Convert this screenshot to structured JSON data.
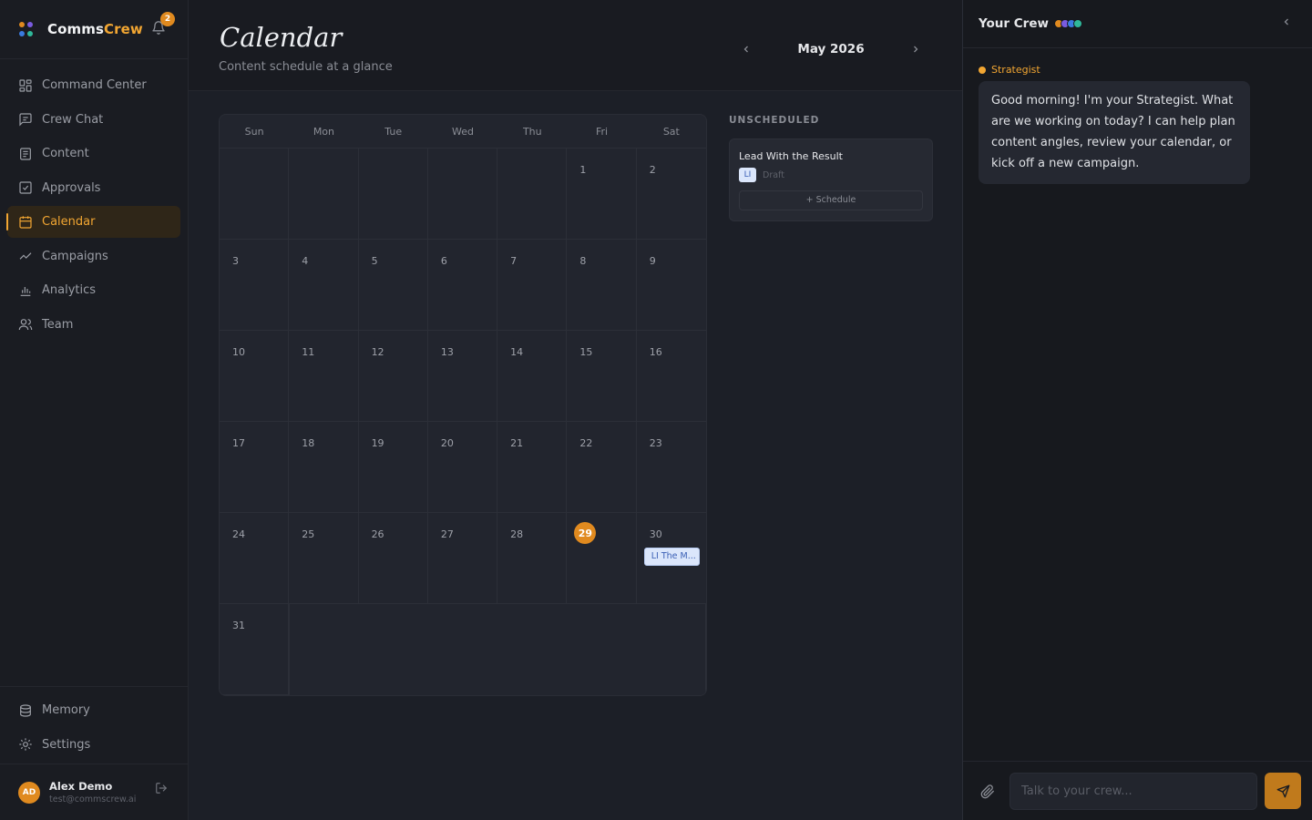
{
  "brand": {
    "name_main": "Comms",
    "name_accent": "Crew",
    "notification_count": "2"
  },
  "sidebar": {
    "items": [
      {
        "label": "Command Center",
        "icon": "dashboard-icon"
      },
      {
        "label": "Crew Chat",
        "icon": "chat-icon"
      },
      {
        "label": "Content",
        "icon": "document-icon"
      },
      {
        "label": "Approvals",
        "icon": "checkbox-icon"
      },
      {
        "label": "Calendar",
        "icon": "calendar-icon",
        "active": true
      },
      {
        "label": "Campaigns",
        "icon": "trend-icon"
      },
      {
        "label": "Analytics",
        "icon": "bar-chart-icon"
      },
      {
        "label": "Team",
        "icon": "users-icon"
      }
    ],
    "bottom_items": [
      {
        "label": "Memory",
        "icon": "database-icon"
      },
      {
        "label": "Settings",
        "icon": "gear-icon"
      }
    ],
    "user": {
      "initials": "AD",
      "name": "Alex Demo",
      "email": "test@commscrew.ai"
    }
  },
  "header": {
    "title": "Calendar",
    "subtitle": "Content schedule at a glance",
    "month": "May 2026"
  },
  "calendar": {
    "weekdays": [
      "Sun",
      "Mon",
      "Tue",
      "Wed",
      "Thu",
      "Fri",
      "Sat"
    ],
    "leading_blanks": 5,
    "days_in_month": 31,
    "today": "29",
    "events": {
      "30": "LI The M..."
    }
  },
  "unscheduled": {
    "title": "UNSCHEDULED",
    "card": {
      "title": "Lead With the Result",
      "channel": "LI",
      "status": "Draft",
      "action": "+ Schedule"
    }
  },
  "crew": {
    "title": "Your Crew",
    "dot_colors": [
      "#e08a1f",
      "#7a5be0",
      "#3a7be0",
      "#2fb89a"
    ],
    "agent": "Strategist",
    "message": "Good morning! I'm your Strategist. What are we working on today? I can help plan content angles, review your calendar, or kick off a new campaign.",
    "input_placeholder": "Talk to your crew..."
  },
  "colors": {
    "accent": "#f2a632",
    "today": "#e08a1f",
    "background": "#15171d"
  }
}
